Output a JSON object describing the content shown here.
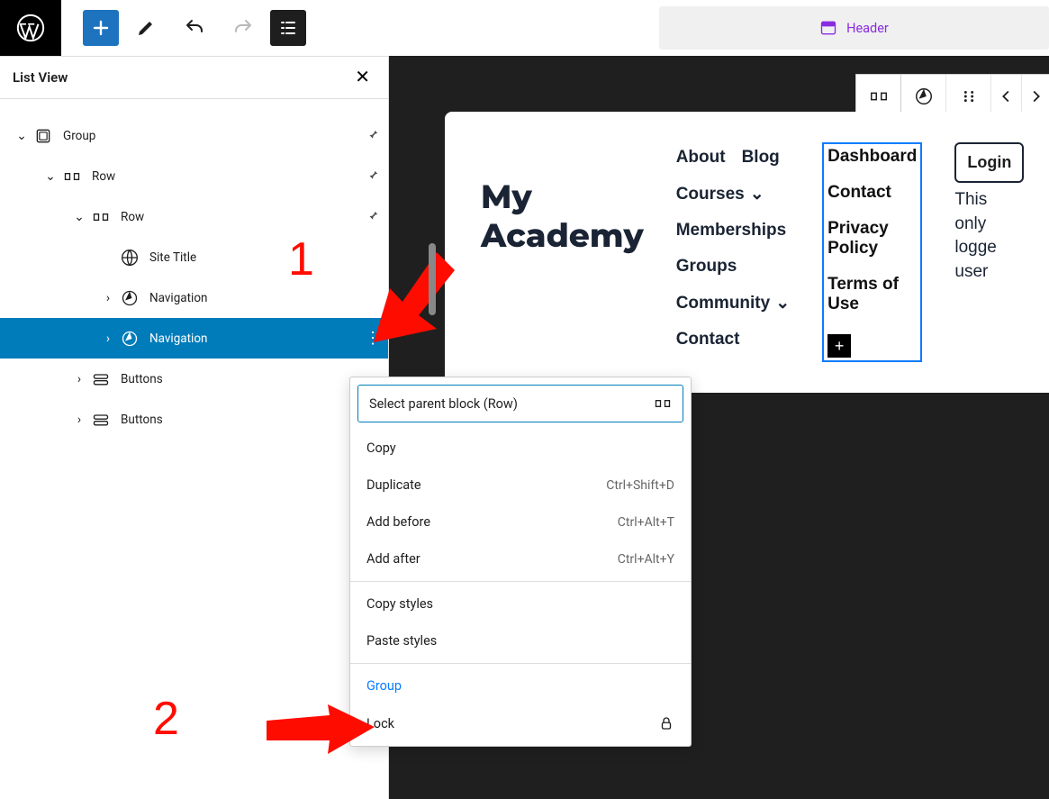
{
  "topbar": {
    "header_label": "Header"
  },
  "listview": {
    "title": "List View",
    "items": [
      {
        "label": "Group"
      },
      {
        "label": "Row"
      },
      {
        "label": "Row"
      },
      {
        "label": "Site Title"
      },
      {
        "label": "Navigation"
      },
      {
        "label": "Navigation"
      },
      {
        "label": "Buttons"
      },
      {
        "label": "Buttons"
      }
    ]
  },
  "preview": {
    "site_title_line1": "My",
    "site_title_line2": "Academy",
    "menu1": [
      "About",
      "Blog",
      "Courses",
      "Memberships",
      "Groups",
      "Community",
      "Contact"
    ],
    "nav2": [
      "Dashboard",
      "Contact",
      "Privacy Policy",
      "Terms of Use"
    ],
    "login_label": "Login",
    "right_text_lines": [
      "This",
      "only",
      "logge",
      "user"
    ]
  },
  "context_menu": {
    "parent_label": "Select parent block (Row)",
    "items": [
      {
        "label": "Copy",
        "kbd": ""
      },
      {
        "label": "Duplicate",
        "kbd": "Ctrl+Shift+D"
      },
      {
        "label": "Add before",
        "kbd": "Ctrl+Alt+T"
      },
      {
        "label": "Add after",
        "kbd": "Ctrl+Alt+Y"
      }
    ],
    "style_items": [
      {
        "label": "Copy styles"
      },
      {
        "label": "Paste styles"
      }
    ],
    "group_label": "Group",
    "lock_label": "Lock"
  },
  "annotations": {
    "num1": "1",
    "num2": "2"
  }
}
